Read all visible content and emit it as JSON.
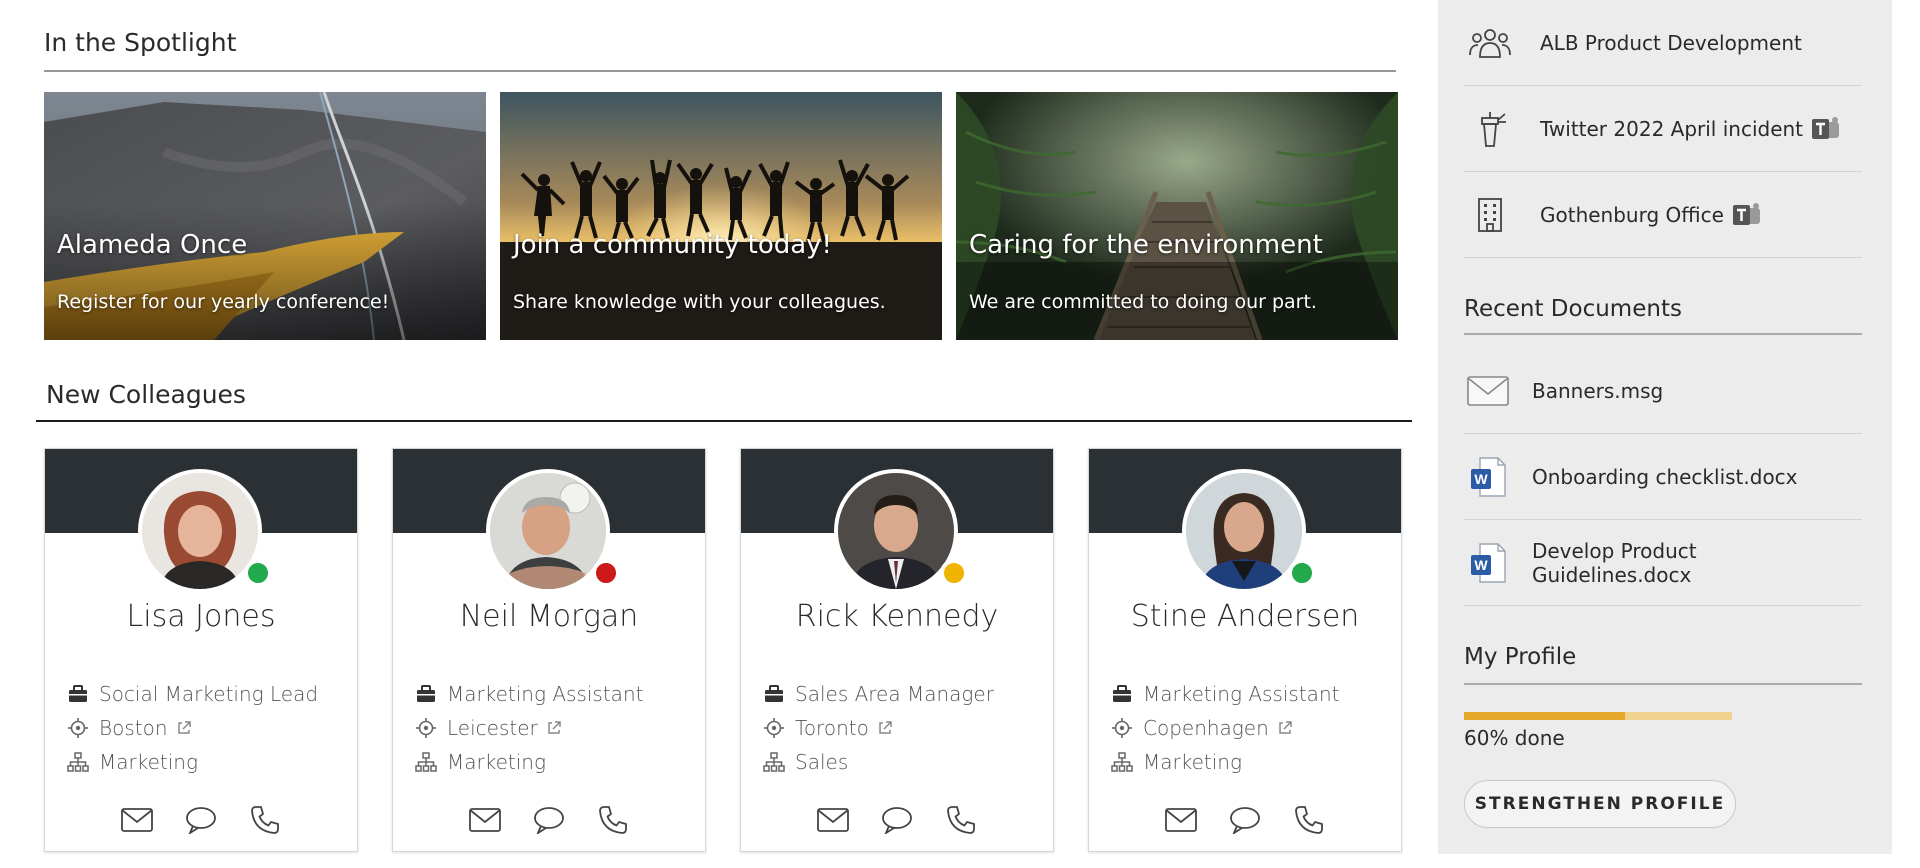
{
  "spotlight": {
    "title": "In the Spotlight",
    "cards": [
      {
        "title": "Alameda Once",
        "subtitle": "Register for our yearly conference!"
      },
      {
        "title": "Join a community today!",
        "subtitle": "Share knowledge with your colleagues."
      },
      {
        "title": "Caring for the environment",
        "subtitle": "We are committed to doing our part."
      }
    ]
  },
  "colleagues": {
    "title": "New Colleagues",
    "people": [
      {
        "name": "Lisa Jones",
        "role": "Social Marketing Lead",
        "location": "Boston",
        "department": "Marketing",
        "presence_color": "#22a94b"
      },
      {
        "name": "Neil Morgan",
        "role": "Marketing Assistant",
        "location": "Leicester",
        "department": "Marketing",
        "presence_color": "#cc1a1a"
      },
      {
        "name": "Rick Kennedy",
        "role": "Sales Area Manager",
        "location": "Toronto",
        "department": "Sales",
        "presence_color": "#f0b400"
      },
      {
        "name": "Stine Andersen",
        "role": "Marketing Assistant",
        "location": "Copenhagen",
        "department": "Marketing",
        "presence_color": "#22a94b"
      }
    ]
  },
  "sidebar": {
    "groups": [
      {
        "label": "ALB Product Development",
        "icon": "people-group-icon"
      },
      {
        "label": "Twitter 2022 April incident",
        "icon": "megaphone-icon"
      },
      {
        "label": "Gothenburg Office",
        "icon": "building-icon"
      }
    ],
    "recent_documents": {
      "title": "Recent Documents",
      "items": [
        {
          "label": "Banners.msg",
          "icon": "mail-icon"
        },
        {
          "label": "Onboarding checklist.docx",
          "icon": "word-doc-icon"
        },
        {
          "label": "Develop Product Guidelines.docx",
          "icon": "word-doc-icon"
        }
      ]
    },
    "profile": {
      "title": "My Profile",
      "progress": 0.6,
      "progress_text": "60% done",
      "button_label": "STRENGTHEN PROFILE"
    }
  },
  "colors": {
    "header_dark": "#2b3035",
    "progress_fill": "#e5a82a",
    "progress_track": "#f0d48e",
    "sidebar_bg": "#ececec"
  }
}
